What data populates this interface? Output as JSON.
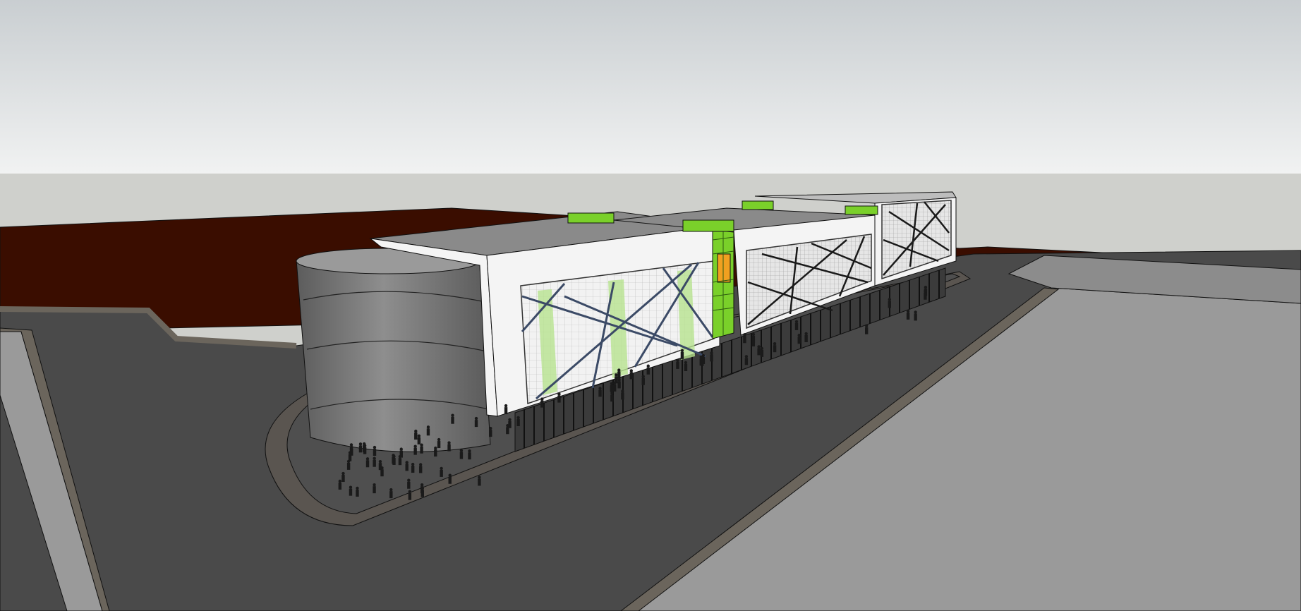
{
  "viewport": {
    "description_hidden": "",
    "colors": {
      "sky_top": "#c9ced1",
      "sky_bottom": "#f1f2f2",
      "ground_far": "#cfd0cc",
      "site_soil": "#3a0d00",
      "road": "#4a4a4a",
      "curb": "#6b655c",
      "sidewalk": "#8c8c8c",
      "plaza": "#9b9b9b",
      "facade_white": "#f4f4f4",
      "roof": "#8a8a8a",
      "cylinder_dark": "#6a6a6a",
      "cylinder_light": "#8e8e8e",
      "accent_green": "#7ad02a",
      "accent_orange": "#f0a020",
      "glass_lines": "#3b4a66",
      "people": "#1a1a1a"
    }
  }
}
